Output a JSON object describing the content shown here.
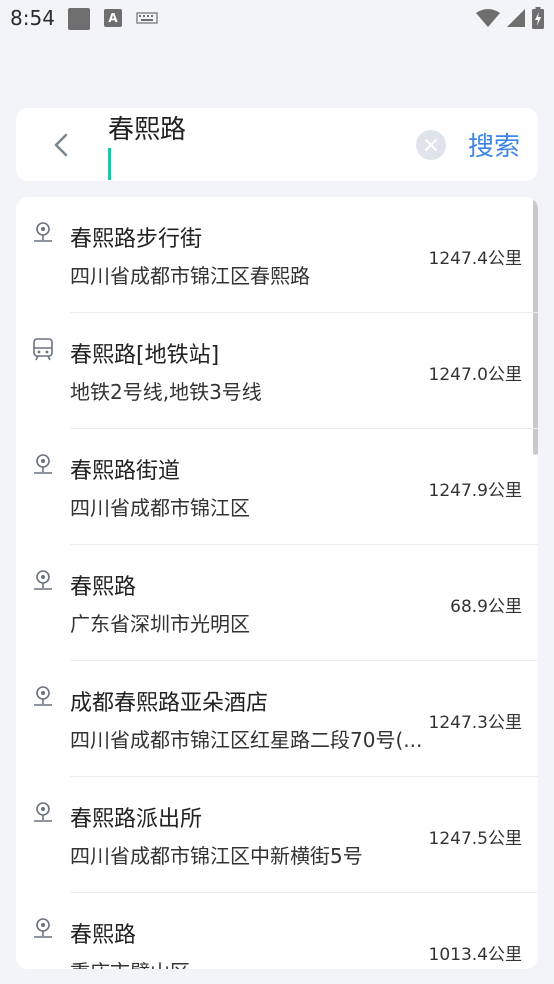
{
  "status_bar": {
    "time": "8:54",
    "icons": [
      "square-icon",
      "a-icon",
      "keyboard-icon",
      "wifi-icon",
      "signal-icon",
      "battery-icon"
    ],
    "a_glyph": "A"
  },
  "search": {
    "value": "春熙路",
    "search_label": "搜索",
    "accent_color": "#3d86e8",
    "caret_color": "#23c4a6"
  },
  "results": [
    {
      "icon": "location-pin-icon",
      "title": "春熙路步行街",
      "subtitle": "四川省成都市锦江区春熙路",
      "distance": "1247.4公里"
    },
    {
      "icon": "bus-icon",
      "title": "春熙路[地铁站]",
      "subtitle": "地铁2号线,地铁3号线",
      "distance": "1247.0公里"
    },
    {
      "icon": "location-pin-icon",
      "title": "春熙路街道",
      "subtitle": "四川省成都市锦江区",
      "distance": "1247.9公里"
    },
    {
      "icon": "location-pin-icon",
      "title": "春熙路",
      "subtitle": "广东省深圳市光明区",
      "distance": "68.9公里"
    },
    {
      "icon": "location-pin-icon",
      "title": "成都春熙路亚朵酒店",
      "subtitle": "四川省成都市锦江区红星路二段70号(...",
      "distance": "1247.3公里"
    },
    {
      "icon": "location-pin-icon",
      "title": "春熙路派出所",
      "subtitle": "四川省成都市锦江区中新横街5号",
      "distance": "1247.5公里"
    },
    {
      "icon": "location-pin-icon",
      "title": "春熙路",
      "subtitle": "重庆市璧山区",
      "distance": "1013.4公里"
    }
  ]
}
